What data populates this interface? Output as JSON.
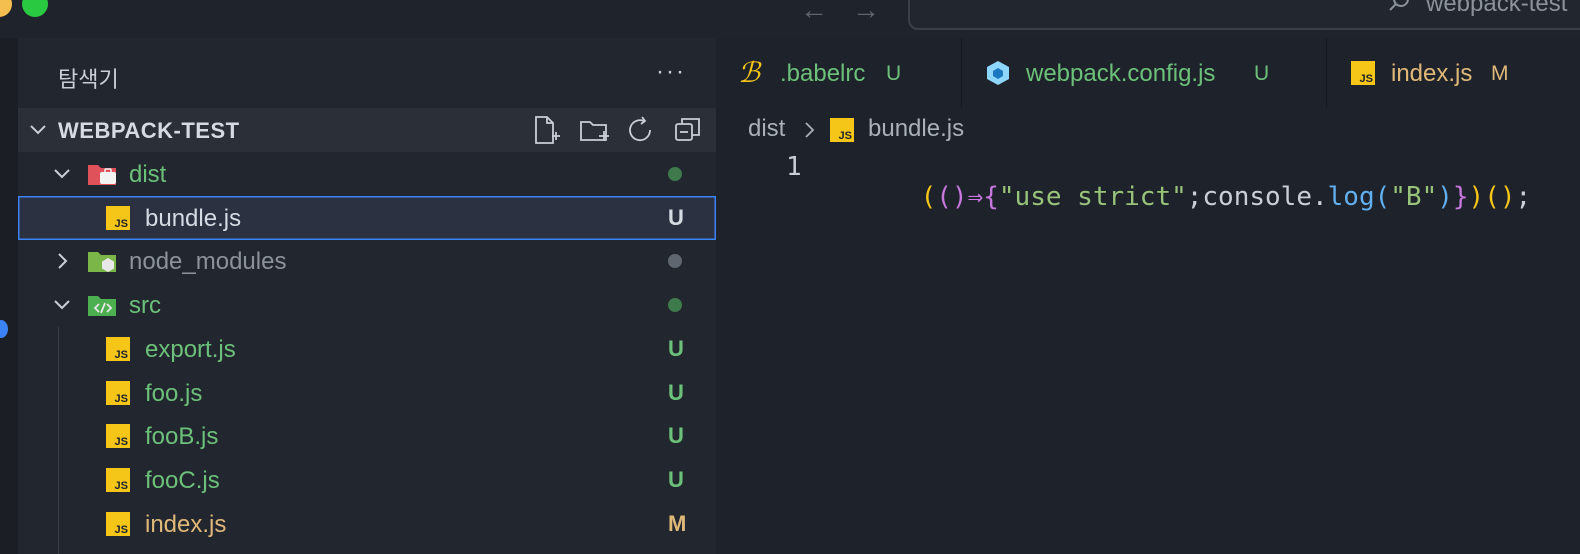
{
  "explorer": {
    "title": "탐색기",
    "more_label": "···",
    "project": "WEBPACK-TEST",
    "tree": [
      {
        "label": "dist",
        "kind": "folder",
        "expanded": true,
        "status": "dot",
        "color": "#6cc17a"
      },
      {
        "label": "bundle.js",
        "kind": "js",
        "status": "U",
        "color": "#d6dbe3",
        "selected": true
      },
      {
        "label": "node_modules",
        "kind": "folder",
        "expanded": false,
        "status": "dot",
        "color": "#8c929c"
      },
      {
        "label": "src",
        "kind": "folder",
        "expanded": true,
        "status": "dot",
        "color": "#6cc17a"
      },
      {
        "label": "export.js",
        "kind": "js",
        "status": "U",
        "color": "#6cc17a"
      },
      {
        "label": "foo.js",
        "kind": "js",
        "status": "U",
        "color": "#6cc17a"
      },
      {
        "label": "fooB.js",
        "kind": "js",
        "status": "U",
        "color": "#6cc17a"
      },
      {
        "label": "fooC.js",
        "kind": "js",
        "status": "U",
        "color": "#6cc17a"
      },
      {
        "label": "index.js",
        "kind": "js",
        "status": "M",
        "color": "#e0b979"
      }
    ]
  },
  "command_center": {
    "text": "webpack-test"
  },
  "tabs": [
    {
      "label": ".babelrc",
      "status": "U",
      "icon": "babel-icon"
    },
    {
      "label": "webpack.config.js",
      "status": "U",
      "icon": "webpack-icon"
    },
    {
      "label": "index.js",
      "status": "M",
      "icon": "js-icon"
    }
  ],
  "breadcrumb": {
    "folder": "dist",
    "file": "bundle.js"
  },
  "editor": {
    "line_number": "1",
    "code": "(()⇒{\"use strict\";console.log(\"B\")})();"
  },
  "colors": {
    "accent": "#3b82f6",
    "untracked": "#6cc17a",
    "modified": "#e0b979",
    "js_badge": "#f5c518"
  }
}
